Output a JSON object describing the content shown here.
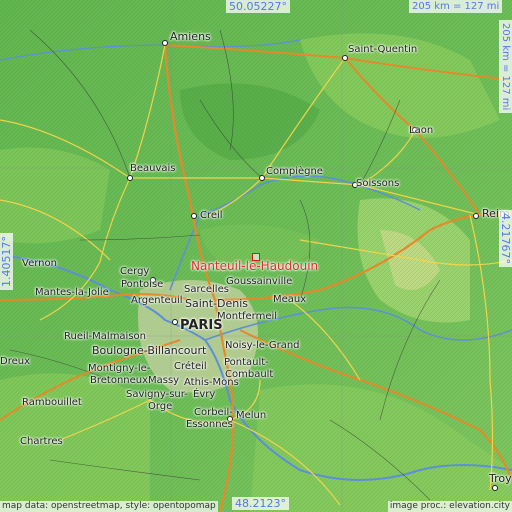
{
  "coords": {
    "top_lat": "50.05227°",
    "bottom_lat": "48.2123°",
    "left_lon": "1.40517°",
    "right_lon": "4.21767°",
    "scale_horizontal": "205 km = 127 mi",
    "scale_vertical": "205 km = 127 mi"
  },
  "highlight": {
    "name": "Nanteuil-le-Haudouin"
  },
  "cities": {
    "amiens": "Amiens",
    "saint_quentin": "Saint-Quentin",
    "laon": "Laon",
    "beauvais": "Beauvais",
    "compiegne": "Compiègne",
    "soissons": "Soissons",
    "reims": "Reim",
    "creil": "Creil",
    "vernon": "Vernon",
    "cergy": "Cergy",
    "pontoise": "Pontoise",
    "goussainville": "Goussainville",
    "sarcelles": "Sarcelles",
    "mantes": "Mantes-la-Jolie",
    "argenteuil": "Argenteuil",
    "saint_denis": "Saint-Denis",
    "meaux": "Meaux",
    "montfermeil": "Montfermeil",
    "paris": "PARIS",
    "rueil": "Rueil-Malmaison",
    "boulogne": "Boulogne-Billancourt",
    "noisy": "Noisy-le-Grand",
    "dreux": "Dreux",
    "montigny": "Montigny-le-",
    "bretonneux": "Bretonneux",
    "creteil": "Créteil",
    "pontault": "Pontault-",
    "combault": "Combault",
    "massy": "Massy",
    "athis": "Athis-Mons",
    "rambouillet": "Rambouillet",
    "savigny": "Savigny-sur-",
    "orge": "Orge",
    "evry": "Évry",
    "corbeil": "Corbeil-",
    "essonnes": "Essonnes",
    "melun": "Melun",
    "chartres": "Chartres",
    "troyes": "Troy"
  },
  "credits": {
    "left": "map data: openstreetmap, style: opentopomap",
    "right": "image proc.: elevation.city"
  },
  "colors": {
    "lowland": "#57b04a",
    "midland": "#8fcf5e",
    "highland": "#c9d98a",
    "highlight": "#e03030",
    "coord_text": "#5577ee"
  }
}
